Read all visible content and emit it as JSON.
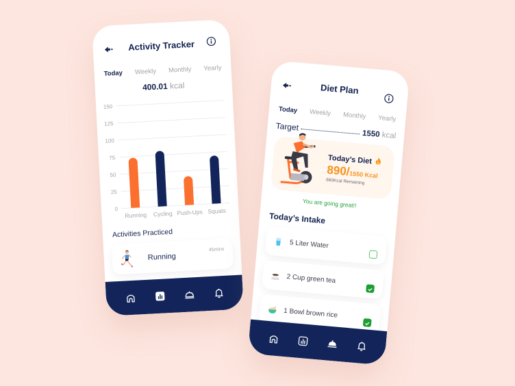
{
  "colors": {
    "background": "#fde6df",
    "navy": "#12245a",
    "orange": "#fb6f2f",
    "accent_orange": "#f7931e",
    "green": "#22a33a",
    "muted": "#a4a4ad"
  },
  "activity_tracker": {
    "title": "Activity Tracker",
    "back_icon": "back-arrow-icon",
    "info_icon": "info-icon",
    "tabs": [
      {
        "label": "Today",
        "active": true
      },
      {
        "label": "Weekly",
        "active": false
      },
      {
        "label": "Monthly",
        "active": false
      },
      {
        "label": "Yearly",
        "active": false
      }
    ],
    "total_value": "400.01",
    "total_unit": "kcal",
    "chart_data": {
      "type": "bar",
      "categories": [
        "Running",
        "Cycling",
        "Push-Ups",
        "Squats"
      ],
      "values": [
        73,
        81,
        42,
        70
      ],
      "bar_colors": [
        "#fb6f2f",
        "#12245a",
        "#fb6f2f",
        "#12245a"
      ],
      "yticks": [
        0,
        25,
        50,
        75,
        100,
        125,
        150
      ],
      "ylim": [
        0,
        150
      ],
      "grid": true,
      "title": "",
      "xlabel": "",
      "ylabel": ""
    },
    "activities_title": "Activities Practiced",
    "activities": [
      {
        "name": "Running",
        "duration": "45mins",
        "icon": "runner-icon"
      }
    ],
    "nav": [
      {
        "name": "home-icon",
        "active": false
      },
      {
        "name": "stats-icon",
        "active": true
      },
      {
        "name": "food-cloche-icon",
        "active": false
      },
      {
        "name": "bell-icon",
        "active": false
      }
    ]
  },
  "diet_plan": {
    "title": "Diet Plan",
    "back_icon": "back-arrow-icon",
    "info_icon": "info-icon",
    "tabs": [
      {
        "label": "Today",
        "active": true
      },
      {
        "label": "Weekly",
        "active": false
      },
      {
        "label": "Monthly",
        "active": false
      },
      {
        "label": "Yearly",
        "active": false
      }
    ],
    "target_label": "Target",
    "target_value": "1550",
    "target_unit": "kcal",
    "today_diet_title": "Today’s Diet",
    "consumed": "890/",
    "goal": "1550 Kcal",
    "remaining": "660Kcal Remaining",
    "encouragement": "You are going great!!",
    "intake_title": "Today’s Intake",
    "intake": [
      {
        "label": "5 Liter Water",
        "icon": "water-glass-icon",
        "checked": false
      },
      {
        "label": "2 Cup green tea",
        "icon": "tea-cup-icon",
        "checked": true
      },
      {
        "label": "1 Bowl brown rice",
        "icon": "rice-bowl-icon",
        "checked": true
      }
    ],
    "nav": [
      {
        "name": "home-icon",
        "active": false
      },
      {
        "name": "stats-icon",
        "active": false
      },
      {
        "name": "food-cloche-icon",
        "active": true
      },
      {
        "name": "bell-icon",
        "active": false
      }
    ]
  }
}
